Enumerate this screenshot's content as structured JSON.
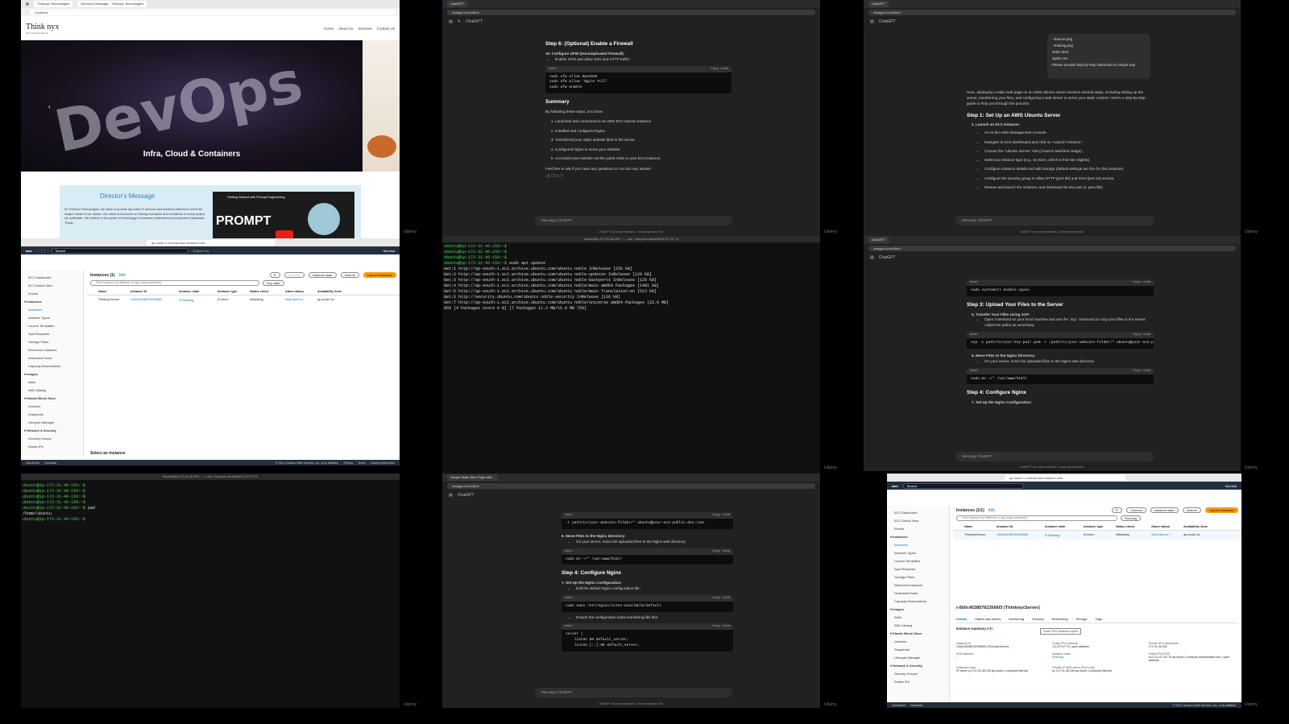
{
  "watermark": "Udemy",
  "tile1": {
    "tab_title": "Thinknyx Technologies",
    "tab2_title": "Director's Message - Thinknyx Technologies",
    "url": "localhost",
    "logo_text": "Think nyx",
    "logo_sub": "The Tech Architects",
    "nav": [
      "Home",
      "About Us",
      "Services",
      "Contact Us"
    ],
    "hero_text": "DevOps",
    "hero_caption": "Infra, Cloud & Containers",
    "director_title": "Director's Message",
    "director_body": "At Thinknyx Technologies, we strive to provide top-notch IT services and solutions tailored to meet the unique needs of our clients. Our vision is anchored on driving innovation and excellence in every project we undertake. We believe in the power of technology to transform businesses and empower individuals. Thank",
    "video_title": "Getting Started with Prompt Engineering",
    "video_word": "PROMPT"
  },
  "chat_tab": "ChatGPT",
  "chat_url": "chatgpt.com/c/6bcf",
  "chat_model": "ChatGPT",
  "chat_input": "Message ChatGPT",
  "chat_footer": "ChatGPT can make mistakes. Check important info.",
  "copy_code": "Copy code",
  "bash": "bash",
  "tile2": {
    "step6": "Step 6: (Optional) Enable a Firewall",
    "item10": "10.  Configure UFW (Uncomplicated Firewall):",
    "bullet": "Enable UFW and allow SSH and HTTP traffic:",
    "code": [
      "sudo ufw allow OpenSSH",
      "sudo ufw allow 'Nginx Full'",
      "sudo ufw enable"
    ],
    "summary": "Summary",
    "summary_intro": "By following these steps, you have:",
    "summary_items": [
      "Launched and connected to an AWS EC2 Ubuntu instance.",
      "Installed and configured Nginx.",
      "Transferred your static website files to the server.",
      "Configured Nginx to serve your website.",
      "Accessed your website via the public DNS or your EC2 instance."
    ],
    "closing": "Feel free to ask if you have any questions or run into any issues!"
  },
  "tile3": {
    "files": [
      "--banner.png",
      "--training.png",
      "index.html",
      "styles.css"
    ],
    "user_msg": "Please provide step-by-step instruction in simple way",
    "answer": "Sure, deploying a static web page on an AWS Ubuntu server involves several steps, including setting up the server, transferring your files, and configuring a web server to serve your static content. Here's a step-by-step guide to help you through the process:",
    "step1": "Step 1: Set Up an AWS Ubuntu Server",
    "sub1": "1.  Launch an EC2 Instance:",
    "bullets": [
      "Go to the AWS Management Console.",
      "Navigate to EC2 Dashboard and click on \"Launch Instance.\"",
      "Choose the \"Ubuntu Server\" AMI (Amazon Machine Image).",
      "Select an instance type (e.g., t2.micro, which is free-tier eligible).",
      "Configure instance details and add storage (default settings are fine for this purpose).",
      "Configure the security group to allow HTTP (port 80) and SSH (port 22) access.",
      "Review and launch the instance, and download the key pair (a .pem file)."
    ]
  },
  "tile4": {
    "url": "ap-south-1.console.aws.amazon.com",
    "search": "Search",
    "shortcut": "[Option+S]",
    "region": "Mumbai",
    "sidebar": [
      {
        "label": "EC2 Dashboard",
        "type": "item"
      },
      {
        "label": "EC2 Global View",
        "type": "item"
      },
      {
        "label": "Events",
        "type": "item"
      },
      {
        "label": "Instances",
        "type": "head"
      },
      {
        "label": "Instances",
        "type": "sel"
      },
      {
        "label": "Instance Types",
        "type": "item"
      },
      {
        "label": "Launch Templates",
        "type": "item"
      },
      {
        "label": "Spot Requests",
        "type": "item"
      },
      {
        "label": "Savings Plans",
        "type": "item"
      },
      {
        "label": "Reserved Instances",
        "type": "item"
      },
      {
        "label": "Dedicated Hosts",
        "type": "item"
      },
      {
        "label": "Capacity Reservations",
        "type": "item"
      },
      {
        "label": "Images",
        "type": "head"
      },
      {
        "label": "AMIs",
        "type": "item"
      },
      {
        "label": "AMI Catalog",
        "type": "item"
      },
      {
        "label": "Elastic Block Store",
        "type": "head"
      },
      {
        "label": "Volumes",
        "type": "item"
      },
      {
        "label": "Snapshots",
        "type": "item"
      },
      {
        "label": "Lifecycle Manager",
        "type": "item"
      },
      {
        "label": "Network & Security",
        "type": "head"
      },
      {
        "label": "Security Groups",
        "type": "item"
      },
      {
        "label": "Elastic IPs",
        "type": "item"
      }
    ],
    "instances_title": "Instances (1)",
    "info": "Info",
    "connect": "Connect",
    "instance_state": "Instance state",
    "actions": "Actions",
    "launch": "Launch instances",
    "filter_placeholder": "Find Instance by attribute or tag (case-sensitive)",
    "any_state": "Any state",
    "columns": [
      "Name",
      "Instance ID",
      "Instance state",
      "Instance type",
      "Status check",
      "Alarm status",
      "Availability Zone"
    ],
    "row": [
      "ThinknyxServer",
      "i-0b0c453857623566f3",
      "Running",
      "t2.micro",
      "Initializing",
      "View alarms +",
      "ap-south-1a"
    ],
    "select": "Select an instance",
    "footer": "© 2024, Amazon Web Services, Inc. or its affiliates.",
    "footer_links": [
      "Privacy",
      "Terms",
      "Cookie preferences"
    ],
    "cloudshell": "CloudShell",
    "feedback": "Feedback"
  },
  "tile5": {
    "title": "ubuntu@ip-172-31-46-159: ~ — ssh -i key.pem ubuntu@13.127.67.70",
    "lines": [
      {
        "p": "ubuntu@ip-172-31-46-159:~$",
        "c": ""
      },
      {
        "p": "ubuntu@ip-172-31-46-159:~$",
        "c": ""
      },
      {
        "p": "ubuntu@ip-172-31-46-159:~$",
        "c": ""
      },
      {
        "p": "ubuntu@ip-172-31-46-159:~$",
        "c": " sudo apt update"
      },
      {
        "p": "",
        "c": "Get:1 http://ap-south-1.ec2.archive.ubuntu.com/ubuntu noble InRelease [256 kB]"
      },
      {
        "p": "",
        "c": "Get:2 http://ap-south-1.ec2.archive.ubuntu.com/ubuntu noble-updates InRelease [126 kB]"
      },
      {
        "p": "",
        "c": "Get:3 http://ap-south-1.ec2.archive.ubuntu.com/ubuntu noble-backports InRelease [126 kB]"
      },
      {
        "p": "",
        "c": "Get:4 http://ap-south-1.ec2.archive.ubuntu.com/ubuntu noble/main amd64 Packages [1401 kB]"
      },
      {
        "p": "",
        "c": "Get:5 http://ap-south-1.ec2.archive.ubuntu.com/ubuntu noble/main Translation-en [513 kB]"
      },
      {
        "p": "",
        "c": "Get:6 http://security.ubuntu.com/ubuntu noble-security InRelease [126 kB]"
      },
      {
        "p": "",
        "c": "Get:7 http://ap-south-1.ec2.archive.ubuntu.com/ubuntu noble/universe amd64 Packages [15.0 MB]"
      },
      {
        "p": "",
        "c": "85% [4 Packages store 0 B] [7 Packages 11.2 MB/15.0 MB 75%]"
      }
    ]
  },
  "tile6": {
    "pre": "sudo systemctl enable nginx",
    "step3": "Step 3: Upload Your Files to the Server",
    "sub5": "5.  Transfer Your Files Using SCP:",
    "b5": "Open a terminal on your local machine and use the `scp` command to copy your files to the server. Adjust the paths as necessary:",
    "code5": "scp -i path/to/your-key-pair.pem -r /path/to/your-website-folder/* ubuntu@your-ec2-public-dns:~",
    "sub6": "6.  Move Files to the Nginx Directory:",
    "b6": "On your server, move the uploaded files to the Nginx web directory:",
    "code6": "sudo mv ~/* /var/www/html/",
    "step4": "Step 4: Configure Nginx",
    "sub7": "7.  Set Up the Nginx Configuration:"
  },
  "tile7": {
    "title": "ubuntu@ip-172-31-46-159: ~ — ssh -i key.pem ubuntu@13.127.67.70",
    "lines": [
      {
        "p": "ubuntu@ip-172-31-46-159:~$",
        "c": ""
      },
      {
        "p": "ubuntu@ip-172-31-46-159:~$",
        "c": ""
      },
      {
        "p": "ubuntu@ip-172-31-46-159:~$",
        "c": ""
      },
      {
        "p": "ubuntu@ip-172-31-46-159:~$",
        "c": ""
      },
      {
        "p": "ubuntu@ip-172-31-46-159:~$",
        "c": " pwd"
      },
      {
        "p": "",
        "c": "/home/ubuntu"
      },
      {
        "p": "ubuntu@ip-172-31-46-159:~$",
        "c": " "
      }
    ]
  },
  "tile8": {
    "tab": "Simple Static Web Page with...",
    "code_top": "-r path/to/your-website-folder/* ubuntu@your-ec2-public-dns:/var",
    "sub6": "6.  Move Files to the Nginx Directory:",
    "b6": "On your server, move the uploaded files to the Nginx web directory:",
    "code6": "sudo mv ~/* /var/www/html/",
    "step4": "Step 4: Configure Nginx",
    "sub7": "7.  Set Up the Nginx Configuration:",
    "b7": "Edit the default Nginx configuration file:",
    "code7": "sudo nano /etc/nginx/sites-available/default",
    "b8": "Ensure the configuration looks something like this:",
    "code8": [
      "server {",
      "    listen 80 default_server;",
      "    listen [::]:80 default_server;"
    ]
  },
  "tile9": {
    "url": "ap-south-1.console.aws.amazon.com",
    "instances_title": "Instances (1/1)",
    "running": "Running",
    "detail_title": "i-0b0c453857623566f3 (ThinknyxServer)",
    "detail_tabs": [
      "Details",
      "Status and alarms",
      "Monitoring",
      "Security",
      "Networking",
      "Storage",
      "Tags"
    ],
    "summary": "Instance summary",
    "info": "Info",
    "copied": "Public IPv4 address copied",
    "labels": [
      "Instance ID",
      "Public IPv4 address",
      "Private IPv4 addresses",
      "IPv6 address",
      "Instance state",
      "Public IPv4 DNS",
      "Hostname type",
      "Private IP DNS name (IPv4 only)"
    ],
    "values": [
      "i-0b0c453857623566f3 (ThinknyxServer)",
      "13.127.67.70 | open address",
      "172.31.46.159",
      "–",
      "Running",
      "ec2-13-127-67-70.ap-south-1.compute.amazonaws.com | open address",
      "IP name: ip-172-31-46-159.ap-south-1.compute.internal",
      "ip-172-31-46-159.ap-south-1.compute.internal"
    ]
  }
}
